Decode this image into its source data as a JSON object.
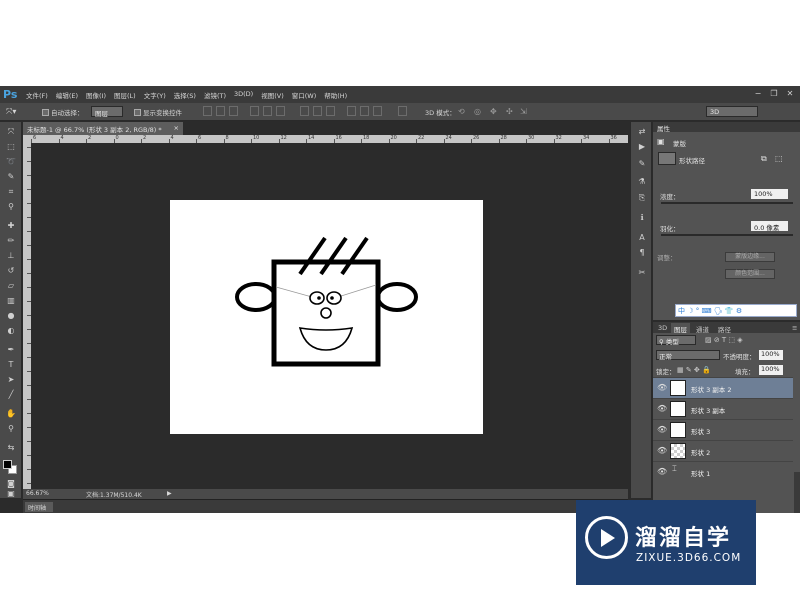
{
  "app": {
    "logo": "Ps"
  },
  "menubar": {
    "items": [
      "文件(F)",
      "编辑(E)",
      "图像(I)",
      "图层(L)",
      "文字(Y)",
      "选择(S)",
      "滤镜(T)",
      "3D(D)",
      "视图(V)",
      "窗口(W)",
      "帮助(H)"
    ],
    "window_buttons": [
      "−",
      "❐",
      "✕"
    ]
  },
  "options": {
    "auto_select_label": "自动选择：",
    "auto_select_value": "图层",
    "show_transform_label": "显示变换控件",
    "mode3d_label": "3D 模式：",
    "workspace_value": "3D"
  },
  "document": {
    "tab_title": "未标题-1 @ 66.7% (形状 3 副本 2, RGB/8) *",
    "tab_close": "×",
    "ruler_numbers": [
      "6",
      "4",
      "2",
      "0",
      "2",
      "4",
      "6",
      "8",
      "10",
      "12",
      "14",
      "16",
      "18",
      "20",
      "22",
      "24",
      "26",
      "28",
      "30",
      "32",
      "34",
      "36"
    ]
  },
  "status": {
    "zoom": "66.67%",
    "doc_size": "文档:1.37M/510.4K",
    "timeline_tab": "时间轴"
  },
  "properties": {
    "header": "属性",
    "mask_label": "蒙版",
    "vector_mask_label": "形状路径",
    "density_label": "浓度：",
    "density_value": "100%",
    "feather_label": "羽化：",
    "feather_value": "0.0 像素",
    "adjust_label": "调整：",
    "mask_edge_button": "蒙版边缘...",
    "color_range_button": "颜色范围..."
  },
  "ime": {
    "text": "中 ☽ ° ⌨ 🗣 👕 ⚙"
  },
  "layers": {
    "tabs": [
      "3D",
      "图层",
      "通道",
      "路径"
    ],
    "active_tab": "图层",
    "filter_value": "类型",
    "blend_mode": "正常",
    "opacity_label": "不透明度：",
    "opacity_value": "100%",
    "lock_label": "锁定：",
    "fill_label": "填充：",
    "fill_value": "100%",
    "items": [
      {
        "name": "形状 3 副本 2",
        "selected": true
      },
      {
        "name": "形状 3 副本",
        "selected": false
      },
      {
        "name": "形状 3",
        "selected": false
      },
      {
        "name": "形状 2",
        "selected": false
      },
      {
        "name": "形状 1",
        "selected": false
      }
    ]
  },
  "watermark": {
    "title": "溜溜自学",
    "url": "ZIXUE.3D66.COM"
  },
  "colors": {
    "selection": "#6e7f96",
    "panel": "#535353",
    "canvas_bg": "#2b2b2b",
    "watermark_bg": "#1f3f6e"
  }
}
